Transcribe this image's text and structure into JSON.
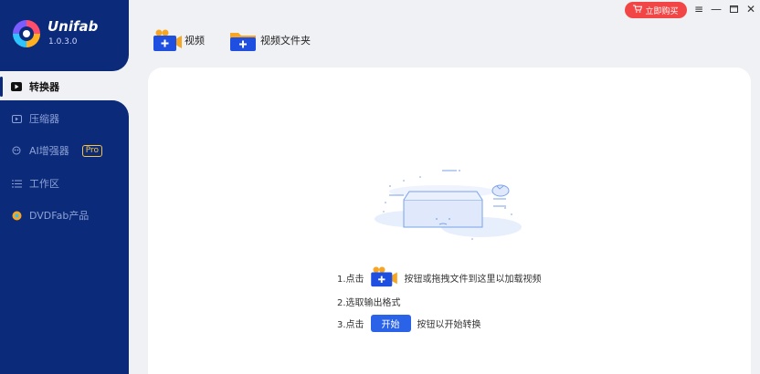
{
  "app": {
    "name": "Unifab",
    "version": "1.0.3.0"
  },
  "sidebar": {
    "items": [
      {
        "label": "转换器",
        "active": true,
        "icon": "play-icon"
      },
      {
        "label": "压缩器",
        "icon": "compress-icon"
      },
      {
        "label": "AI增强器",
        "icon": "ai-icon",
        "badge": "Pro"
      },
      {
        "label": "工作区",
        "icon": "list-icon"
      },
      {
        "label": "DVDFab产品",
        "icon": "dvdfab-icon"
      }
    ]
  },
  "titlebar": {
    "buy_label": "立即购买"
  },
  "toolbar": {
    "video_label": "视频",
    "folder_label": "视频文件夹"
  },
  "main": {
    "steps": [
      {
        "prefix": "1.点击",
        "suffix": "按钮或拖拽文件到这里以加载视频"
      },
      {
        "text": "2.选取输出格式"
      },
      {
        "prefix": "3.点击",
        "button": "开始",
        "suffix": "按钮以开始转换"
      }
    ]
  },
  "colors": {
    "brand": "#0b2a7a",
    "accent": "#2b63e8",
    "buy": "#f24646",
    "folder": "#f6a623"
  }
}
